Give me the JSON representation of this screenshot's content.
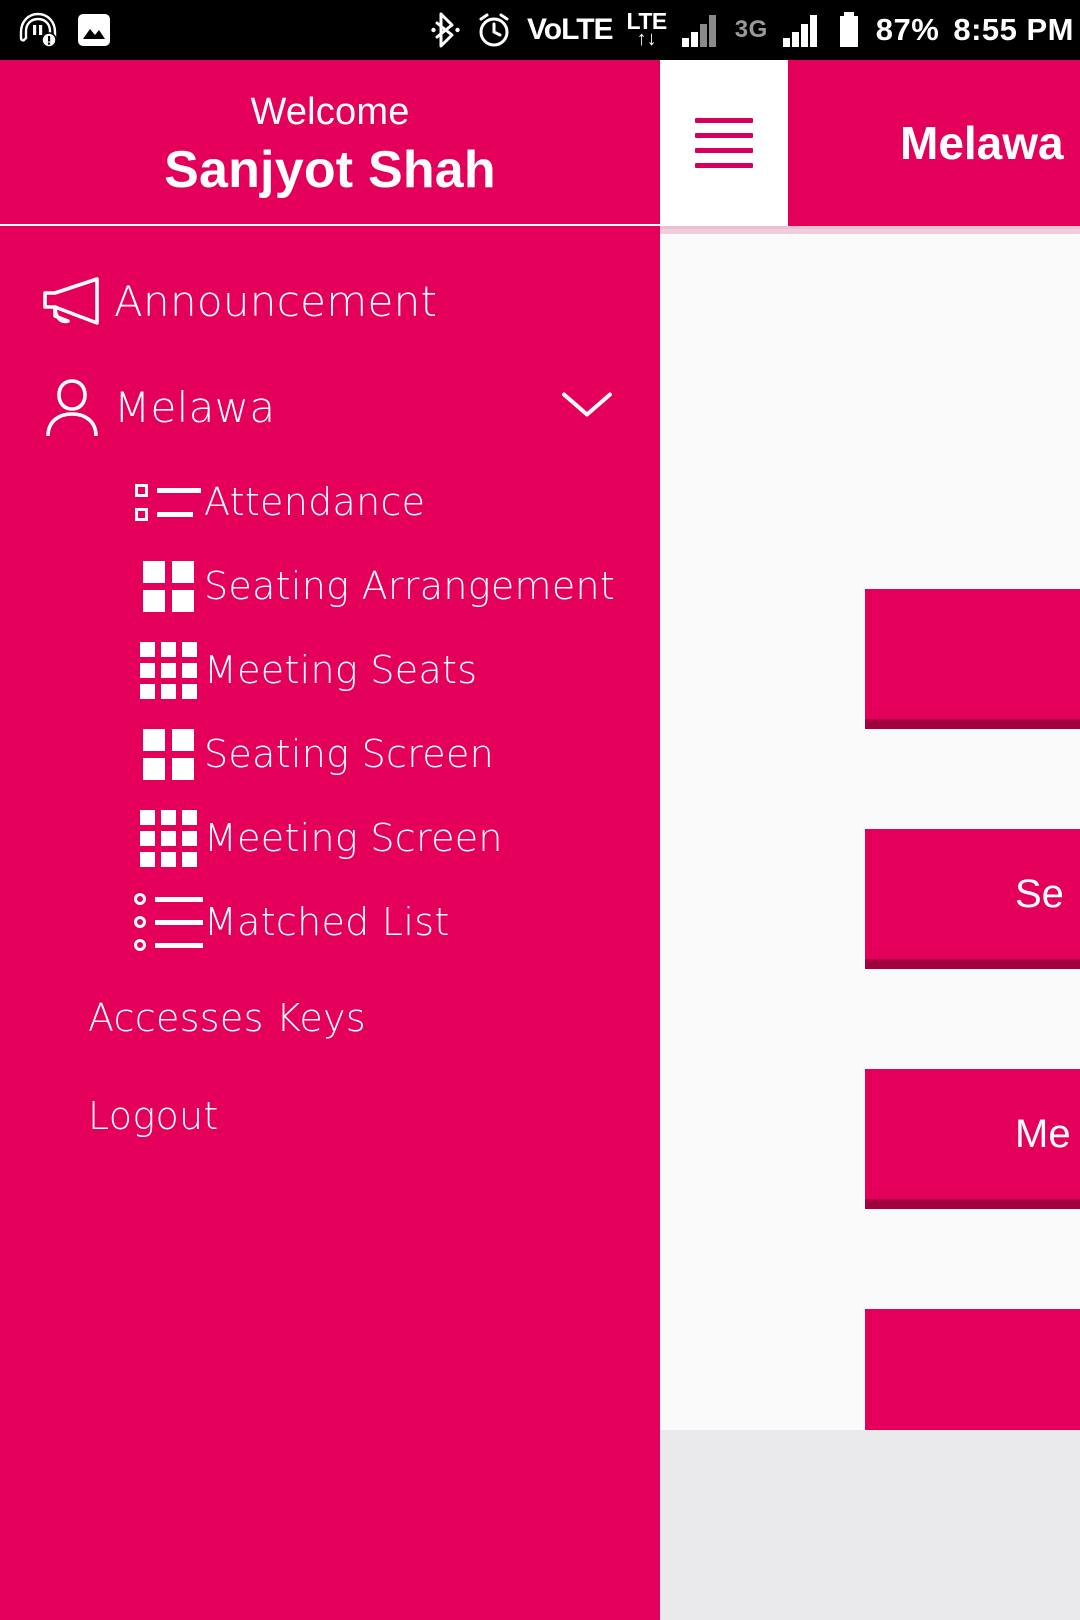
{
  "status_bar": {
    "left_icons": [
      "headset-warning-icon",
      "image-icon"
    ],
    "right_icons": [
      "bluetooth-icon",
      "alarm-icon"
    ],
    "volte_label": "VoLTE",
    "lte_label": "LTE",
    "lte_arrows": "↑↓",
    "network_label": "3G",
    "battery_percent": "87%",
    "time": "8:55 PM",
    "background_color": "#000000",
    "text_color": "#ffffff"
  },
  "app_bar": {
    "title": "Melawa",
    "menu_icon": "hamburger-icon",
    "background_color": "#e4005a",
    "button_background": "#ffffff",
    "icon_color": "#d4005c"
  },
  "drawer": {
    "background_color": "#e4005a",
    "welcome_label": "Welcome",
    "user_name": "Sanjyot Shah",
    "items": [
      {
        "label": "Announcement",
        "icon": "megaphone-icon",
        "expandable": false
      },
      {
        "label": "Melawa",
        "icon": "person-icon",
        "expandable": true,
        "expanded": true,
        "chevron": "chevron-down-icon"
      }
    ],
    "sub_items": [
      {
        "label": "Attendance",
        "icon": "list-squares-icon"
      },
      {
        "label": "Seating Arrangement",
        "icon": "grid-2x2-icon"
      },
      {
        "label": "Meeting Seats",
        "icon": "grid-3x3-icon"
      },
      {
        "label": "Seating Screen",
        "icon": "grid-2x2-icon"
      },
      {
        "label": "Meeting Screen",
        "icon": "grid-3x3-icon"
      },
      {
        "label": "Matched List",
        "icon": "list-dots-icon"
      }
    ],
    "plain_items": [
      {
        "label": "Accesses Keys"
      },
      {
        "label": "Logout"
      }
    ]
  },
  "content": {
    "background_color": "#fafafa",
    "tile_color": "#e4005a",
    "tile_shadow_color": "#a30040",
    "tiles": [
      {
        "label": ""
      },
      {
        "label": "Se"
      },
      {
        "label": "Me"
      },
      {
        "label": ""
      }
    ]
  }
}
